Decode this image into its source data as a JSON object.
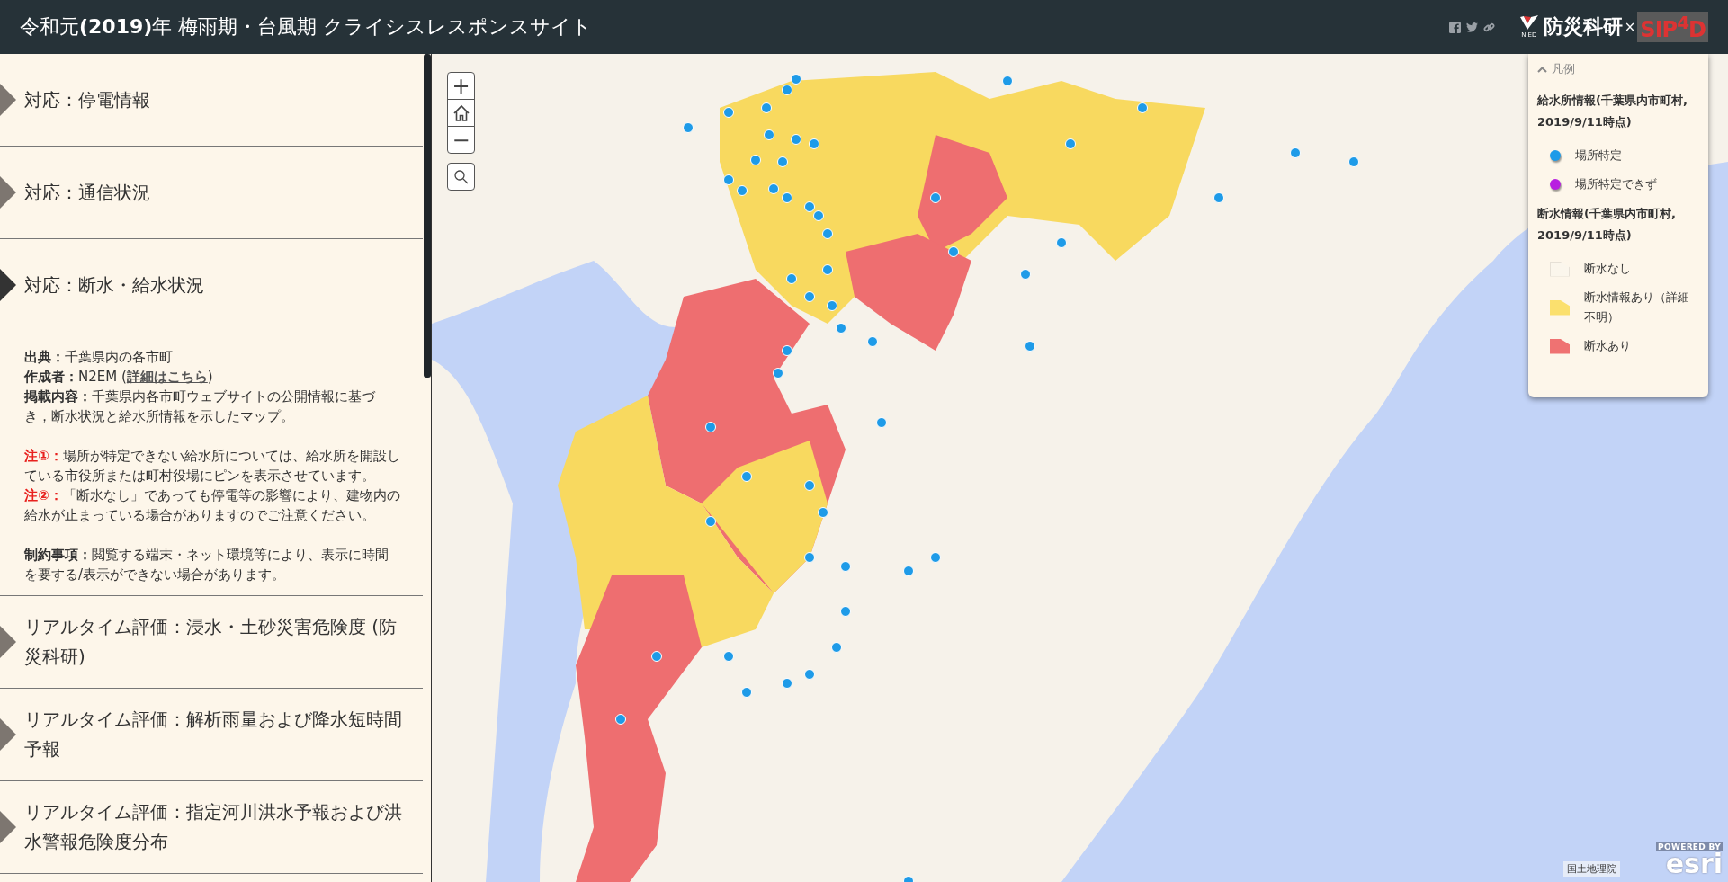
{
  "header": {
    "title": "令和元**(2019)**年 梅雨期・台風期 クライシスレスポンスサイト",
    "share_icons": [
      {
        "kind": "facebook"
      },
      {
        "kind": "twitter"
      },
      {
        "kind": "link"
      }
    ],
    "logo": {
      "caption": "NIED",
      "name": "防災科研",
      "separator": "×",
      "partner": "SIP$^{4}$D"
    }
  },
  "sections": [
    {
      "title": "対応：停電情報",
      "expanded": false
    },
    {
      "title": "対応：通信状況",
      "expanded": false
    },
    {
      "title": "対応：断水・給水状況",
      "expanded": true,
      "content": [
        {
          "lines": [
            {
              "kind": "normal",
              "label": "出典：",
              "text": "千葉県内の各市町"
            },
            {
              "kind": "normal",
              "label": "作成者：",
              "text": "N2EM (",
              "link": "詳細はこちら",
              "after": ")"
            },
            {
              "kind": "normal",
              "label": "掲載内容：",
              "text": "千葉県内各市町ウェブサイトの公開情報に基づき，断水状況と給水所情報を示したマップ。"
            }
          ]
        },
        {
          "lines": [
            {
              "kind": "note",
              "label": "注①：",
              "text": "場所が特定できない給水所については、給水所を開設している市役所または町村役場にピンを表示させています。"
            },
            {
              "kind": "note",
              "label": "注②：",
              "text": "「断水なし」であっても停電等の影響により、建物内の給水が止まっている場合がありますのでご注意ください。"
            }
          ]
        },
        {
          "lines": [
            {
              "kind": "normal",
              "label": "制約事項：",
              "text": "閲覧する端末・ネット環境等により、表示に時間を要する/表示ができない場合があります。"
            }
          ]
        }
      ]
    },
    {
      "title": "リアルタイム評価：浸水・土砂災害危険度 (防災科研)",
      "expanded": false
    },
    {
      "title": "リアルタイム評価：解析雨量および降水短時間予報",
      "expanded": false
    },
    {
      "title": "リアルタイム評価：指定河川洪水予報および洪水警報危険度分布",
      "expanded": false
    }
  ],
  "map_controls": [
    {
      "kind": "zoom-in",
      "label": "+"
    },
    {
      "kind": "home"
    },
    {
      "kind": "zoom-out",
      "label": "−"
    },
    {
      "kind": "search"
    }
  ],
  "legend": {
    "toggle": "凡例",
    "expanded": true,
    "groups": [
      {
        "title": "給水所情報(千葉県内市町村, 2019/9/11時点)",
        "items": [
          {
            "kind": "dot",
            "label": "場所特定",
            "color": "#1e9be8"
          },
          {
            "kind": "dot",
            "label": "場所特定できず",
            "color": "#b81fe0"
          }
        ]
      },
      {
        "title": "断水情報(千葉県内市町村, 2019/9/11時点)",
        "items": [
          {
            "kind": "area",
            "label": "断水なし",
            "color": "#fbf6ec"
          },
          {
            "kind": "area",
            "label": "断水情報あり（詳細不明）",
            "color": "#fbe06e"
          },
          {
            "kind": "area",
            "label": "断水あり",
            "color": "#ef7272"
          }
        ]
      }
    ]
  },
  "attribution": "国土地理院",
  "esri": {
    "powered": "POWERED BY",
    "brand": "esri"
  }
}
